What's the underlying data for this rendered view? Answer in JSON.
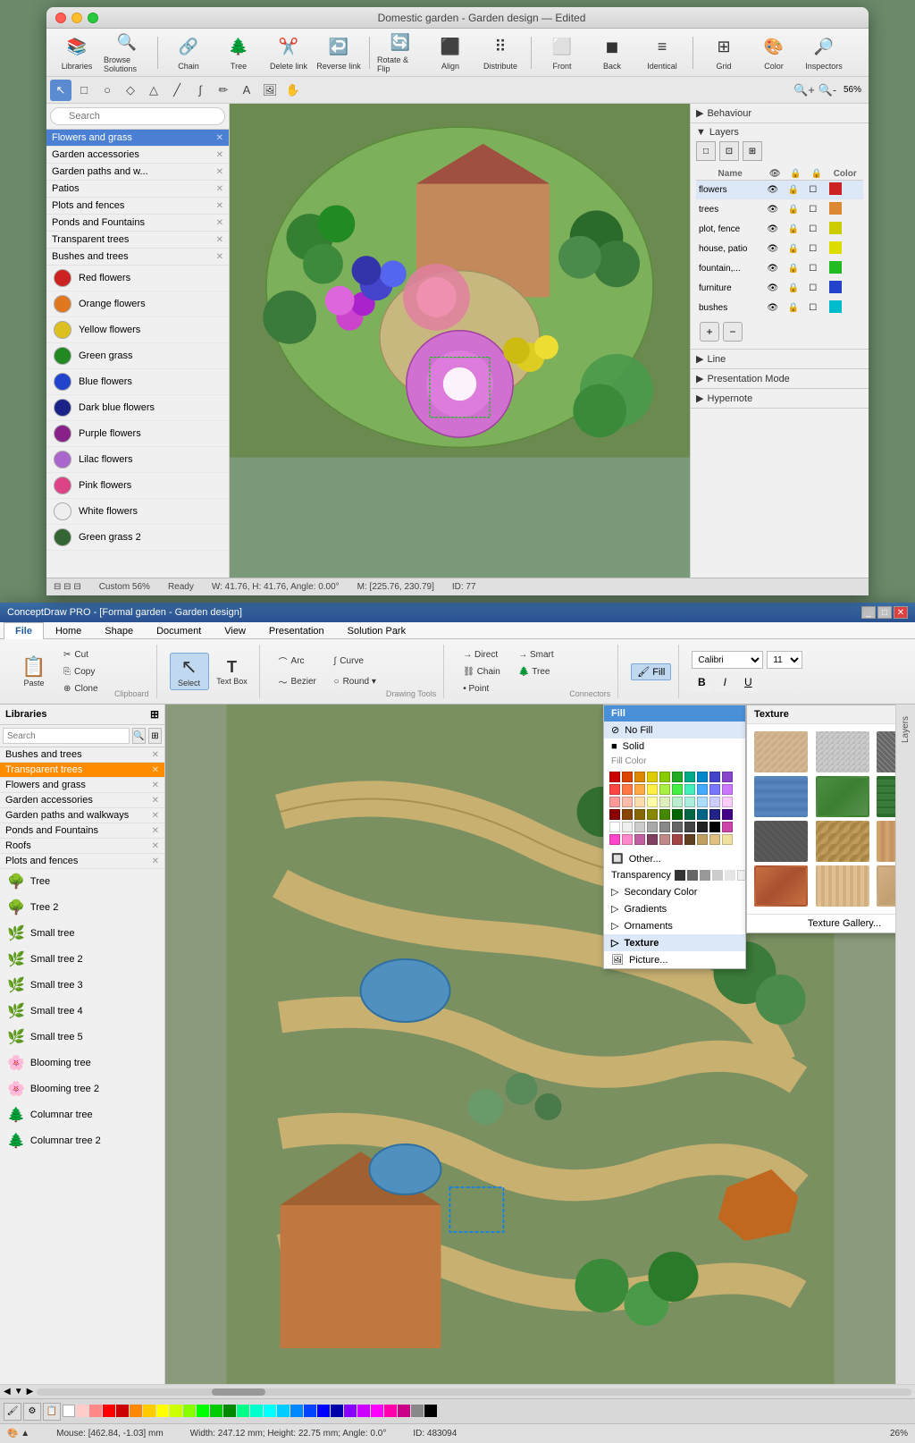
{
  "top_window": {
    "title": "Domestic garden - Garden design — Edited",
    "toolbar": {
      "buttons": [
        {
          "label": "Libraries",
          "icon": "📚"
        },
        {
          "label": "Browse Solutions",
          "icon": "🔍"
        },
        {
          "label": "Chain",
          "icon": "🔗"
        },
        {
          "label": "Tree",
          "icon": "🌲"
        },
        {
          "label": "Delete link",
          "icon": "✂️"
        },
        {
          "label": "Reverse link",
          "icon": "↩️"
        },
        {
          "label": "Rotate & Flip",
          "icon": "🔄"
        },
        {
          "label": "Align",
          "icon": "⬛"
        },
        {
          "label": "Distribute",
          "icon": "⠿"
        },
        {
          "label": "Front",
          "icon": "⬜"
        },
        {
          "label": "Back",
          "icon": "⬛"
        },
        {
          "label": "Identical",
          "icon": "≡"
        },
        {
          "label": "Grid",
          "icon": "⊞"
        },
        {
          "label": "Color",
          "icon": "🎨"
        },
        {
          "label": "Inspectors",
          "icon": "🔎"
        }
      ]
    },
    "categories": [
      {
        "label": "Flowers and grass",
        "active": true
      },
      {
        "label": "Garden accessories"
      },
      {
        "label": "Garden paths and w..."
      },
      {
        "label": "Patios"
      },
      {
        "label": "Plots and fences"
      },
      {
        "label": "Ponds and Fountains"
      },
      {
        "label": "Transparent trees"
      },
      {
        "label": "Bushes and trees"
      }
    ],
    "plants": [
      {
        "label": "Red flowers",
        "color": "#cc2222"
      },
      {
        "label": "Orange flowers",
        "color": "#e07820"
      },
      {
        "label": "Yellow flowers",
        "color": "#ddc020"
      },
      {
        "label": "Green grass",
        "color": "#228822"
      },
      {
        "label": "Blue flowers",
        "color": "#2244cc"
      },
      {
        "label": "Dark blue flowers",
        "color": "#1a2288"
      },
      {
        "label": "Purple flowers",
        "color": "#882288"
      },
      {
        "label": "Lilac flowers",
        "color": "#aa66cc"
      },
      {
        "label": "Pink flowers",
        "color": "#dd4488"
      },
      {
        "label": "White flowers",
        "color": "#eeeeee"
      },
      {
        "label": "Green grass 2",
        "color": "#336633"
      }
    ],
    "right_panel": {
      "behaviour": "Behaviour",
      "layers": "Layers",
      "layer_cols": [
        "Name",
        "👁",
        "🔒",
        "🔒",
        "Color"
      ],
      "layer_rows": [
        {
          "name": "flowers",
          "active": true,
          "color": "#cc2222"
        },
        {
          "name": "trees",
          "color": "#dd8833"
        },
        {
          "name": "plot, fence",
          "color": "#cccc00"
        },
        {
          "name": "house, patio",
          "color": "#dddd00"
        },
        {
          "name": "fountain,...",
          "color": "#22bb22"
        },
        {
          "name": "furniture",
          "color": "#2244cc"
        },
        {
          "name": "bushes",
          "color": "#00bbcc"
        }
      ],
      "line": "Line",
      "presentation_mode": "Presentation Mode",
      "hypernote": "Hypernote"
    }
  },
  "status_bar_top": {
    "ready": "Ready",
    "dimensions": "W: 41.76, H: 41.76, Angle: 0.00°",
    "mouse": "M: [225.76, 230.79]",
    "id": "ID: 77",
    "zoom": "Custom 56%"
  },
  "bottom_window": {
    "title": "ConceptDraw PRO - [Formal garden - Garden design]",
    "tabs": [
      "File",
      "Home",
      "Shape",
      "Document",
      "View",
      "Presentation",
      "Solution Park"
    ],
    "active_tab": "Home",
    "ribbon": {
      "clipboard": {
        "label": "Clipboard",
        "paste": "Paste",
        "cut": "Cut",
        "copy": "Copy",
        "clone": "Clone"
      },
      "select": {
        "label": "Select",
        "icon": "↖"
      },
      "text_box": {
        "label": "Text Box",
        "icon": "T"
      },
      "drawing_tools": {
        "label": "Drawing Tools",
        "items": [
          "Arc",
          "Bezier",
          "→ Direct",
          "→ Smart",
          "→ Chain",
          "→ Tree",
          "→ Point",
          "Curve",
          "Round"
        ]
      },
      "connectors": {
        "label": "Connectors",
        "items": [
          "Direct",
          "Smart",
          "Chain",
          "Tree",
          "Arc",
          "Curve",
          "Bezier",
          "Round",
          "Point"
        ]
      },
      "fill": {
        "label": "Fill",
        "active": true
      },
      "font": {
        "name": "Calibri",
        "size": "11"
      }
    },
    "fill_dropdown": {
      "title": "Fill",
      "no_fill": "No Fill",
      "solid": "Solid",
      "fill_color": "Fill Color",
      "other": "Other...",
      "transparency": "Transparency",
      "secondary_color": "Secondary Color",
      "gradients": "Gradients",
      "ornaments": "Ornaments",
      "texture_label": "Texture",
      "picture": "Picture..."
    },
    "texture_submenu": {
      "title": "Texture",
      "gallery": "Texture Gallery..."
    },
    "libraries": {
      "title": "Libraries",
      "categories": [
        {
          "label": "Bushes and trees"
        },
        {
          "label": "Transparent trees",
          "active": true
        },
        {
          "label": "Flowers and grass"
        },
        {
          "label": "Garden accessories"
        },
        {
          "label": "Garden paths and walkways"
        },
        {
          "label": "Ponds and Fountains"
        },
        {
          "label": "Roofs"
        },
        {
          "label": "Plots and fences"
        }
      ],
      "items": [
        {
          "label": "Tree",
          "icon": "🌳"
        },
        {
          "label": "Tree 2",
          "icon": "🌳"
        },
        {
          "label": "Small tree",
          "icon": "🌿"
        },
        {
          "label": "Small tree 2",
          "icon": "🌿"
        },
        {
          "label": "Small tree 3",
          "icon": "🌿"
        },
        {
          "label": "Small tree 4",
          "icon": "🌿"
        },
        {
          "label": "Small tree 5",
          "icon": "🌿"
        },
        {
          "label": "Blooming tree",
          "icon": "🌸"
        },
        {
          "label": "Blooming tree 2",
          "icon": "🌸"
        },
        {
          "label": "Columnar tree",
          "icon": "🌲"
        },
        {
          "label": "Columnar tree 2",
          "icon": "🌲"
        }
      ]
    },
    "side_tabs": [
      "Layers"
    ],
    "status": {
      "mouse": "Mouse: [462.84, -1.03] mm",
      "dimensions": "Width: 247.12 mm; Height: 22.75 mm; Angle: 0.0°",
      "id": "ID: 483094",
      "zoom": "26%"
    }
  },
  "colors": {
    "accent_blue": "#4a90d9",
    "active_orange": "#ff8c00",
    "layer_highlight": "#dce8f8"
  }
}
